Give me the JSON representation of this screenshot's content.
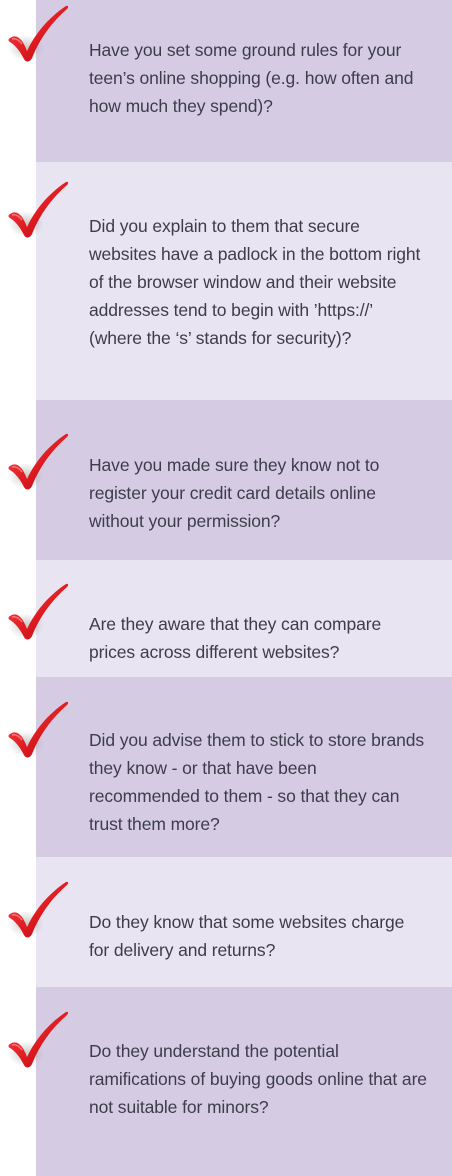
{
  "checklist": {
    "items": [
      {
        "text": "Have you set some ground rules for your teen’s online shopping (e.g. how often and how much they spend)?"
      },
      {
        "text": "Did you explain to them that secure websites have a padlock in the bottom right of the browser window and their website addresses tend to begin with ’https://’ (where the ‘s’ stands for security)?"
      },
      {
        "text": "Have you made sure they know not to register your credit card details online without your permission?"
      },
      {
        "text": "Are they aware that they can compare prices across different websites?"
      },
      {
        "text": "Did you advise them to stick to store brands they know - or that have been recommended to them - so that they can trust them more?"
      },
      {
        "text": "Do they know that some websites charge for delivery and returns?"
      },
      {
        "text": "Do they understand the potential ramifications of buying goods online that are not suitable for minors?"
      }
    ],
    "icon": "red-checkmark-icon",
    "colors": {
      "dark_band": "#d5cce4",
      "light_band": "#e9e4f2",
      "text": "#3d3d4a",
      "check_red": "#d7191f"
    }
  }
}
